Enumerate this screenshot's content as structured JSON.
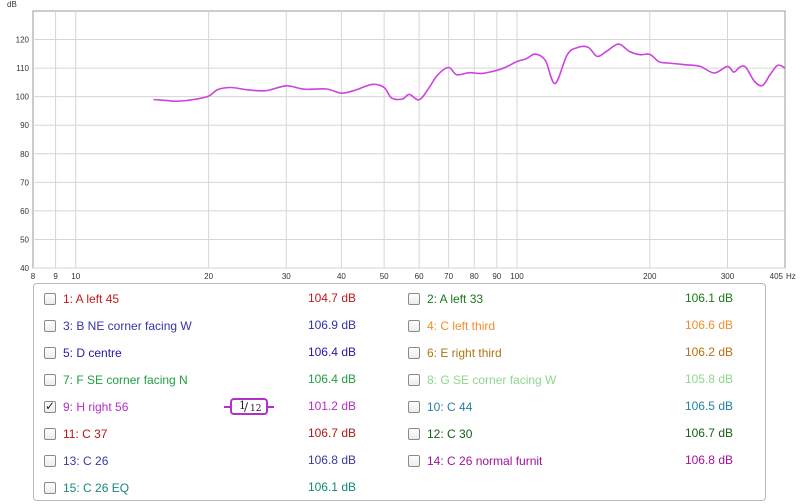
{
  "chart_data": {
    "type": "line",
    "ylabel": "dB",
    "xunit": "Hz",
    "xscale": "log",
    "xlim": [
      8,
      405
    ],
    "ylim": [
      40,
      130
    ],
    "yticks": [
      "120",
      "110",
      "100",
      "90",
      "80",
      "70",
      "60",
      "50",
      "40"
    ],
    "xticks": [
      "8",
      "9",
      "10",
      "20",
      "30",
      "40",
      "50",
      "60",
      "70",
      "80",
      "90",
      "100",
      "200",
      "300",
      "405"
    ],
    "grid": true,
    "series": [
      {
        "color": "#cc44dd",
        "x": [
          15,
          16,
          17,
          18.5,
          20,
          21,
          22.5,
          24.5,
          27,
          30,
          33,
          37,
          40,
          43,
          47,
          50,
          52,
          55,
          57,
          60,
          63,
          66,
          70,
          73,
          78,
          83,
          88,
          94,
          100,
          105,
          110,
          116,
          122,
          130,
          137,
          145,
          152,
          160,
          170,
          180,
          190,
          200,
          210,
          220,
          240,
          260,
          280,
          300,
          310,
          320,
          330,
          345,
          360,
          375,
          390,
          405
        ],
        "values": [
          99,
          98.7,
          98.4,
          99,
          100.2,
          102.5,
          103.2,
          102.4,
          102.1,
          103.8,
          102.6,
          102.7,
          101.2,
          102.3,
          104.3,
          103.2,
          99.5,
          99.2,
          100.8,
          98.9,
          102.8,
          107.5,
          110.2,
          107.7,
          108.4,
          108.1,
          108.8,
          110.2,
          112.3,
          113.3,
          114.9,
          112.7,
          104.6,
          114.7,
          117.2,
          117.3,
          114.1,
          116,
          118.4,
          115.8,
          114.7,
          114.8,
          112.2,
          111.8,
          111.2,
          110.6,
          108.3,
          110.6,
          108.6,
          110.4,
          110.3,
          105.4,
          103.9,
          107.8,
          111,
          110
        ]
      }
    ]
  },
  "legend": [
    {
      "name": "1: A left 45",
      "value": "104.7 dB",
      "checked": false,
      "color": "#c41a1a"
    },
    {
      "name": "2: A left 33",
      "value": "106.1 dB",
      "checked": false,
      "color": "#1b7a1b"
    },
    {
      "name": "3: B NE corner facing W",
      "value": "106.9 dB",
      "checked": false,
      "color": "#3333aa"
    },
    {
      "name": "4: C left third",
      "value": "106.6 dB",
      "checked": false,
      "color": "#ee9030"
    },
    {
      "name": "5: D centre",
      "value": "106.4 dB",
      "checked": false,
      "color": "#2218a8"
    },
    {
      "name": "6: E right third",
      "value": "106.2 dB",
      "checked": false,
      "color": "#b27310"
    },
    {
      "name": "7: F SE corner facing N",
      "value": "106.4 dB",
      "checked": false,
      "color": "#20a040"
    },
    {
      "name": "8: G SE corner facing W",
      "value": "105.8 dB",
      "checked": false,
      "color": "#8fd68f"
    },
    {
      "name": "9: H right 56",
      "value": "101.2 dB",
      "checked": true,
      "color": "#b32fc9",
      "smoothing": {
        "num": "1",
        "den": "12"
      }
    },
    {
      "name": "10: C 44",
      "value": "106.5 dB",
      "checked": false,
      "color": "#2a7fa8"
    },
    {
      "name": "11: C 37",
      "value": "106.7 dB",
      "checked": false,
      "color": "#b01818"
    },
    {
      "name": "12: C 30",
      "value": "106.7 dB",
      "checked": false,
      "color": "#156015"
    },
    {
      "name": "13: C 26",
      "value": "106.8 dB",
      "checked": false,
      "color": "#3a3aa0"
    },
    {
      "name": "14: C 26 normal furnit",
      "value": "106.8 dB",
      "checked": false,
      "color": "#a0129c"
    },
    {
      "name": "15: C 26 EQ",
      "value": "106.1 dB",
      "checked": false,
      "color": "#138a7a"
    }
  ]
}
